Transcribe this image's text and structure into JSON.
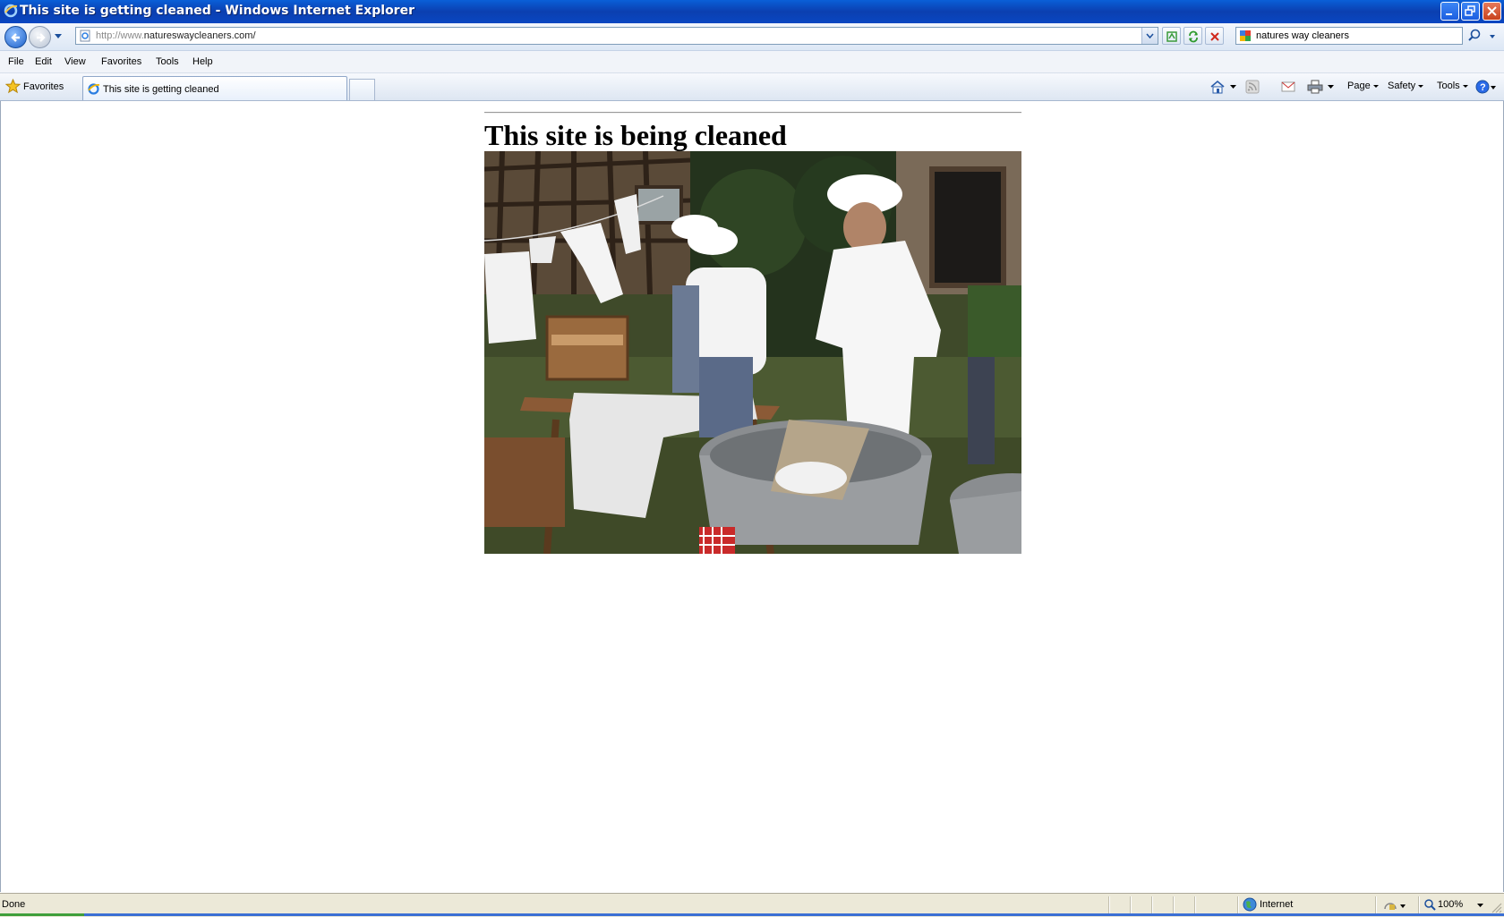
{
  "window": {
    "title": "This site is getting cleaned - Windows Internet Explorer"
  },
  "address_bar": {
    "url_protocol": "http://www.",
    "url_host": "natureswaycleaners.com/"
  },
  "search": {
    "value": "natures way cleaners"
  },
  "menu": [
    "File",
    "Edit",
    "View",
    "Favorites",
    "Tools",
    "Help"
  ],
  "favorites_bar": {
    "favorites_label": "Favorites",
    "tab_label": "This site is getting cleaned"
  },
  "command_bar": {
    "page_label": "Page",
    "safety_label": "Safety",
    "tools_label": "Tools"
  },
  "page": {
    "heading": "This site is being cleaned"
  },
  "status_bar": {
    "status": "Done",
    "zone": "Internet",
    "zoom": "100%"
  },
  "colors": {
    "titlebar": "#0b4fc4",
    "status_bar": "#ece9d8"
  }
}
